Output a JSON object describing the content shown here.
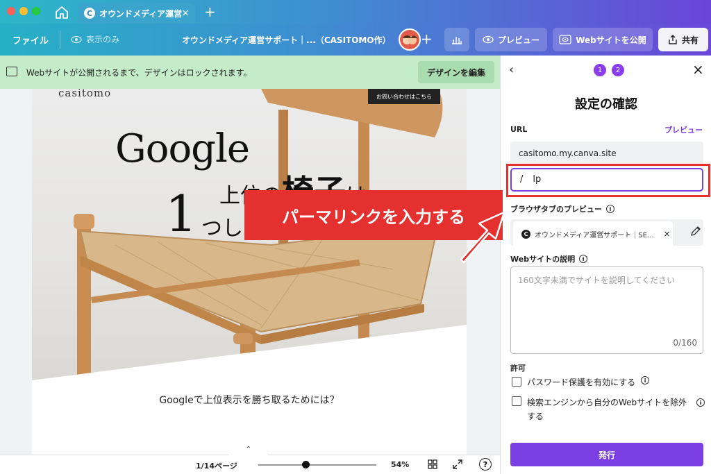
{
  "browser": {
    "tab_title": "オウンドメディア運営",
    "tab_favicon": "C",
    "tab_close": "×",
    "new_tab": "+"
  },
  "toolbar": {
    "file_label": "ファイル",
    "view_only_label": "表示のみ",
    "doc_title": "オウンドメディア運営サポート｜...（CASITOMO作）",
    "add_user": "+",
    "preview_label": "プレビュー",
    "publish_site_label": "Webサイトを公開",
    "share_label": "共有"
  },
  "banner": {
    "message": "Webサイトが公開されるまで、デザインはロックされます。",
    "edit_button": "デザインを編集"
  },
  "design": {
    "brand": "casitomo",
    "contact_button": "お問い合わせはこちら",
    "headline_google": "Google",
    "headline_line2_pre": "上位の",
    "headline_line2_big": "椅子",
    "headline_line2_post": "は",
    "headline_one": "1",
    "headline_line3": "つしかない",
    "subheading": "Googleで上位表示を勝ち取るためには？"
  },
  "callout": {
    "text": "パーマリンクを入力する",
    "color": "#e53030"
  },
  "bottombar": {
    "page_indicator": "1/14ページ",
    "zoom": "54%",
    "zoom_fraction": 0.4,
    "help": "?",
    "expand": "⌃"
  },
  "panel": {
    "back": "‹",
    "close": "×",
    "steps": [
      "1",
      "2"
    ],
    "title": "設定の確認",
    "url_label": "URL",
    "preview_link": "プレビュー",
    "domain": "casitomo.my.canva.site",
    "slug_separator": "/",
    "slug_value": "lp",
    "tab_preview_label": "ブラウザタブのプレビュー",
    "tab_preview_text": "オウンドメディア運営サポート｜SE...",
    "tab_preview_favicon": "C",
    "tab_preview_close": "×",
    "description_label": "Webサイトの説明",
    "description_placeholder": "160文字未満でサイトを説明してください",
    "description_count": "0/160",
    "permission_label": "許可",
    "password_option": "パスワード保護を有効にする",
    "search_option": "検索エンジンから自分のWebサイトを除外する",
    "publish_button": "発行",
    "accent_color": "#7b3fe4"
  }
}
